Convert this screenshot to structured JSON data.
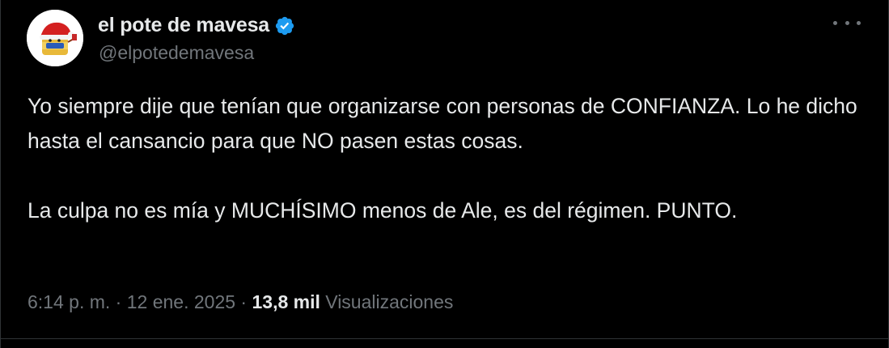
{
  "author": {
    "display_name": "el pote de mavesa",
    "handle": "@elpotedemavesa",
    "verified": true,
    "verified_color": "#1d9bf0"
  },
  "post": {
    "paragraphs": [
      "Yo siempre dije que tenían que organizarse con personas de CONFIANZA. Lo he dicho hasta el cansancio para que NO pasen estas cosas.",
      "La culpa no es mía y MUCHÍSIMO menos de Ale, es del régimen. PUNTO."
    ]
  },
  "meta": {
    "time": "6:14 p. m.",
    "separator": " · ",
    "date": "12 ene. 2025",
    "views_count": "13,8 mil",
    "views_label": "Visualizaciones"
  },
  "icons": {
    "more": "more-options-icon",
    "verified": "verified-badge-icon"
  },
  "colors": {
    "background": "#000000",
    "text_primary": "#e7e9ea",
    "text_secondary": "#71767b"
  }
}
